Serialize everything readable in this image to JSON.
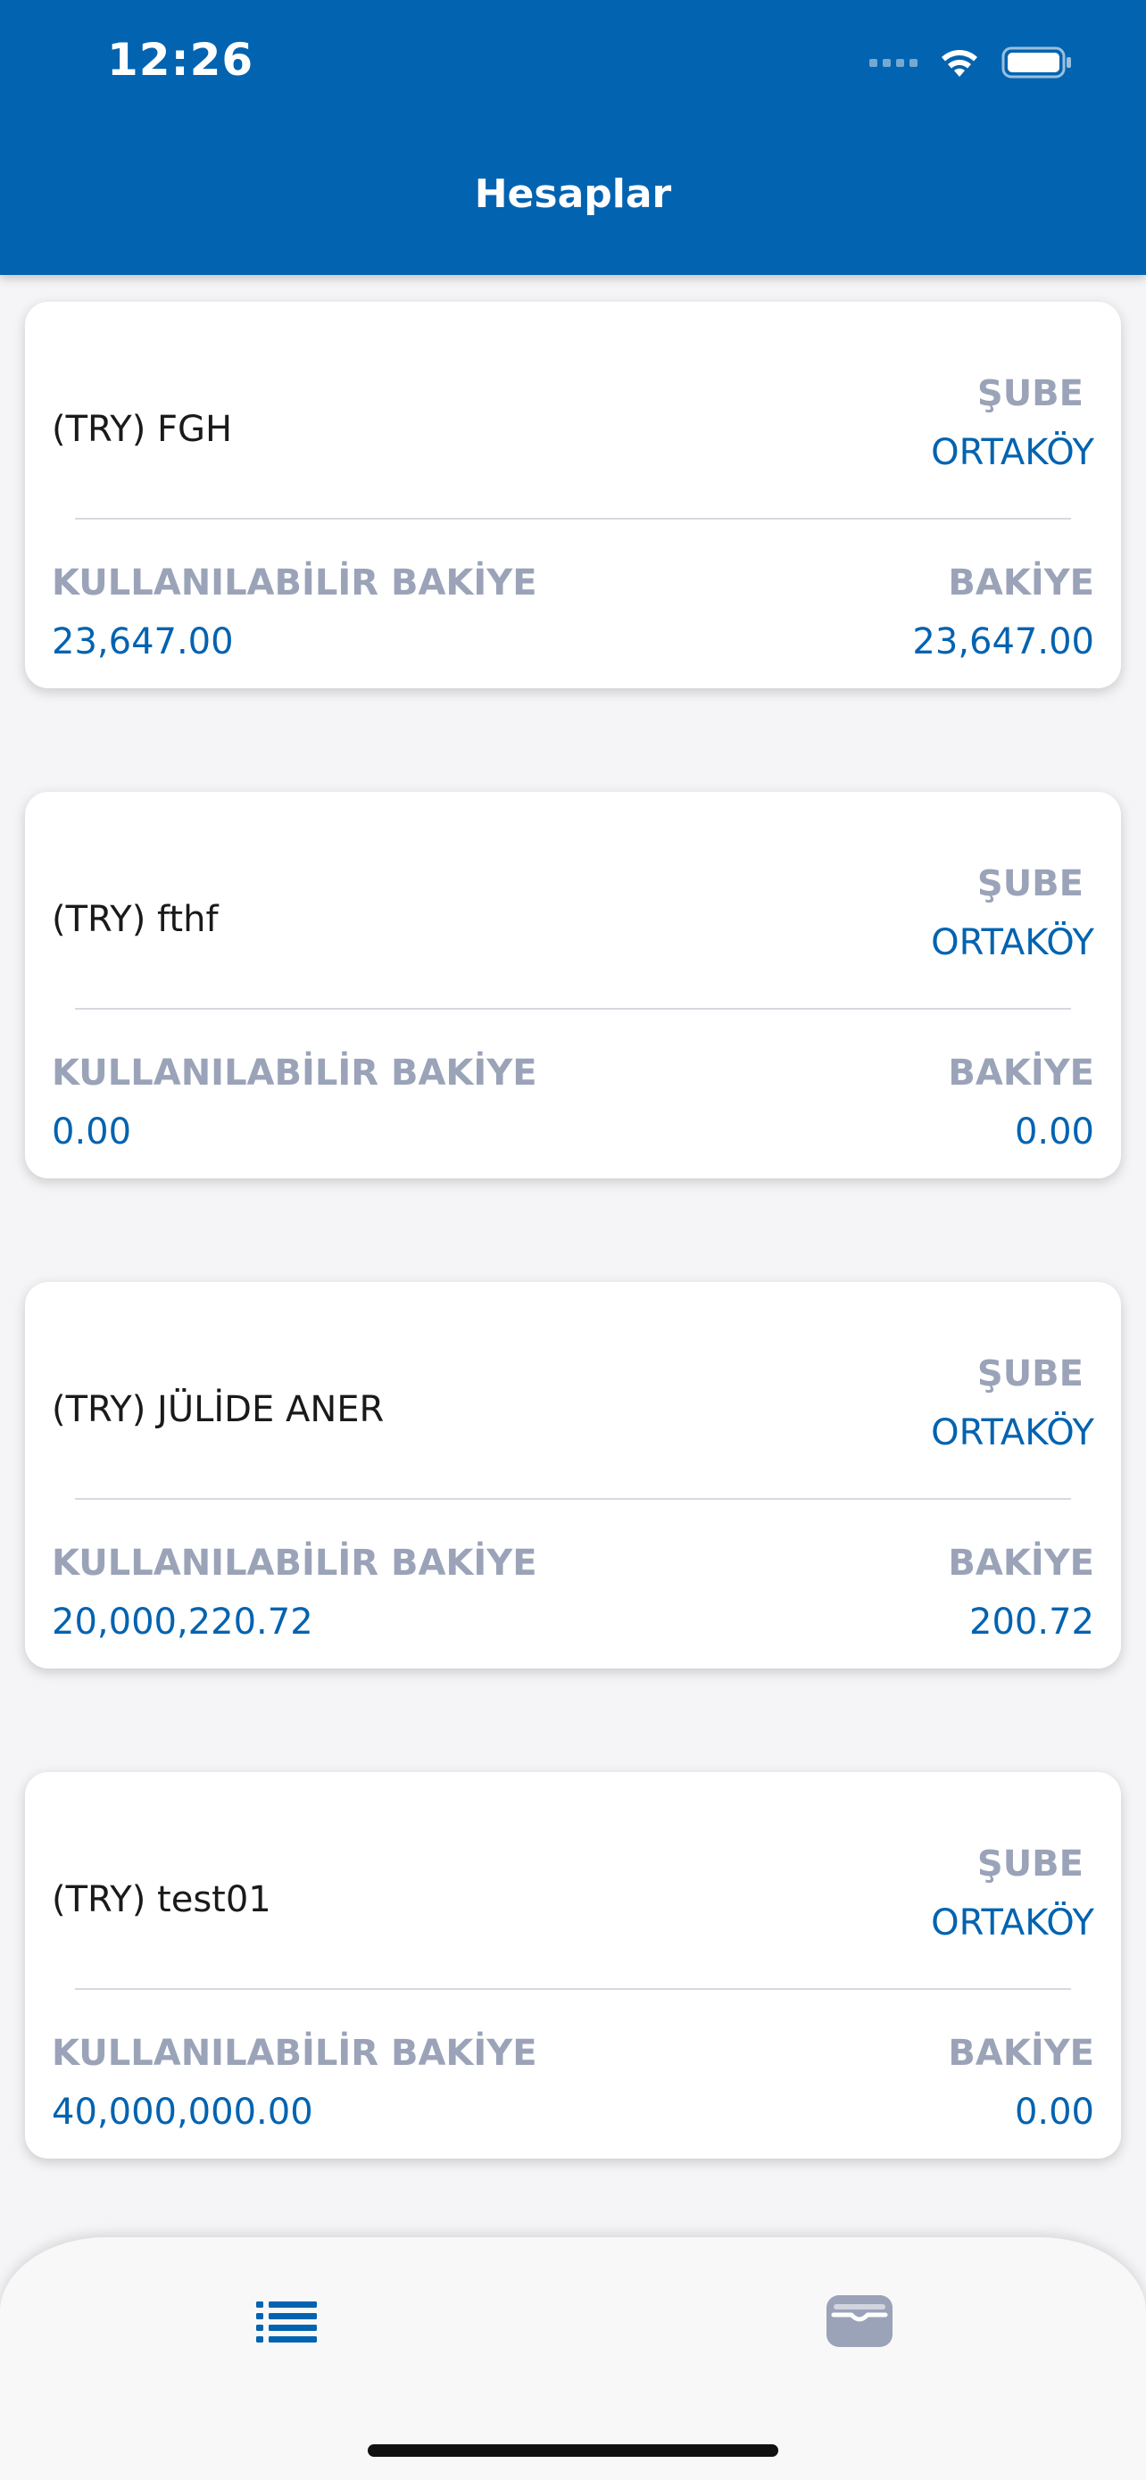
{
  "status_bar": {
    "time": "12:26"
  },
  "header": {
    "title": "Hesaplar"
  },
  "labels": {
    "branch": "ŞUBE",
    "available_balance": "KULLANILABİLİR BAKİYE",
    "balance": "BAKİYE"
  },
  "accounts": [
    {
      "name": "(TRY) FGH",
      "branch": "ORTAKÖY",
      "available_balance": "23,647.00",
      "balance": "23,647.00"
    },
    {
      "name": "(TRY) fthf",
      "branch": "ORTAKÖY",
      "available_balance": "0.00",
      "balance": "0.00"
    },
    {
      "name": "(TRY) JÜLİDE ANER",
      "branch": "ORTAKÖY",
      "available_balance": "20,000,220.72",
      "balance": "200.72"
    },
    {
      "name": "(TRY) test01",
      "branch": "ORTAKÖY",
      "available_balance": "40,000,000.00",
      "balance": "0.00"
    }
  ],
  "tab_bar": {
    "tabs": [
      {
        "icon": "list-icon",
        "active": true
      },
      {
        "icon": "wallet-icon",
        "active": false
      }
    ]
  },
  "colors": {
    "primary": "#0263b0",
    "label_gray": "#9aa3b8",
    "inactive_icon": "#9aa3b8"
  }
}
